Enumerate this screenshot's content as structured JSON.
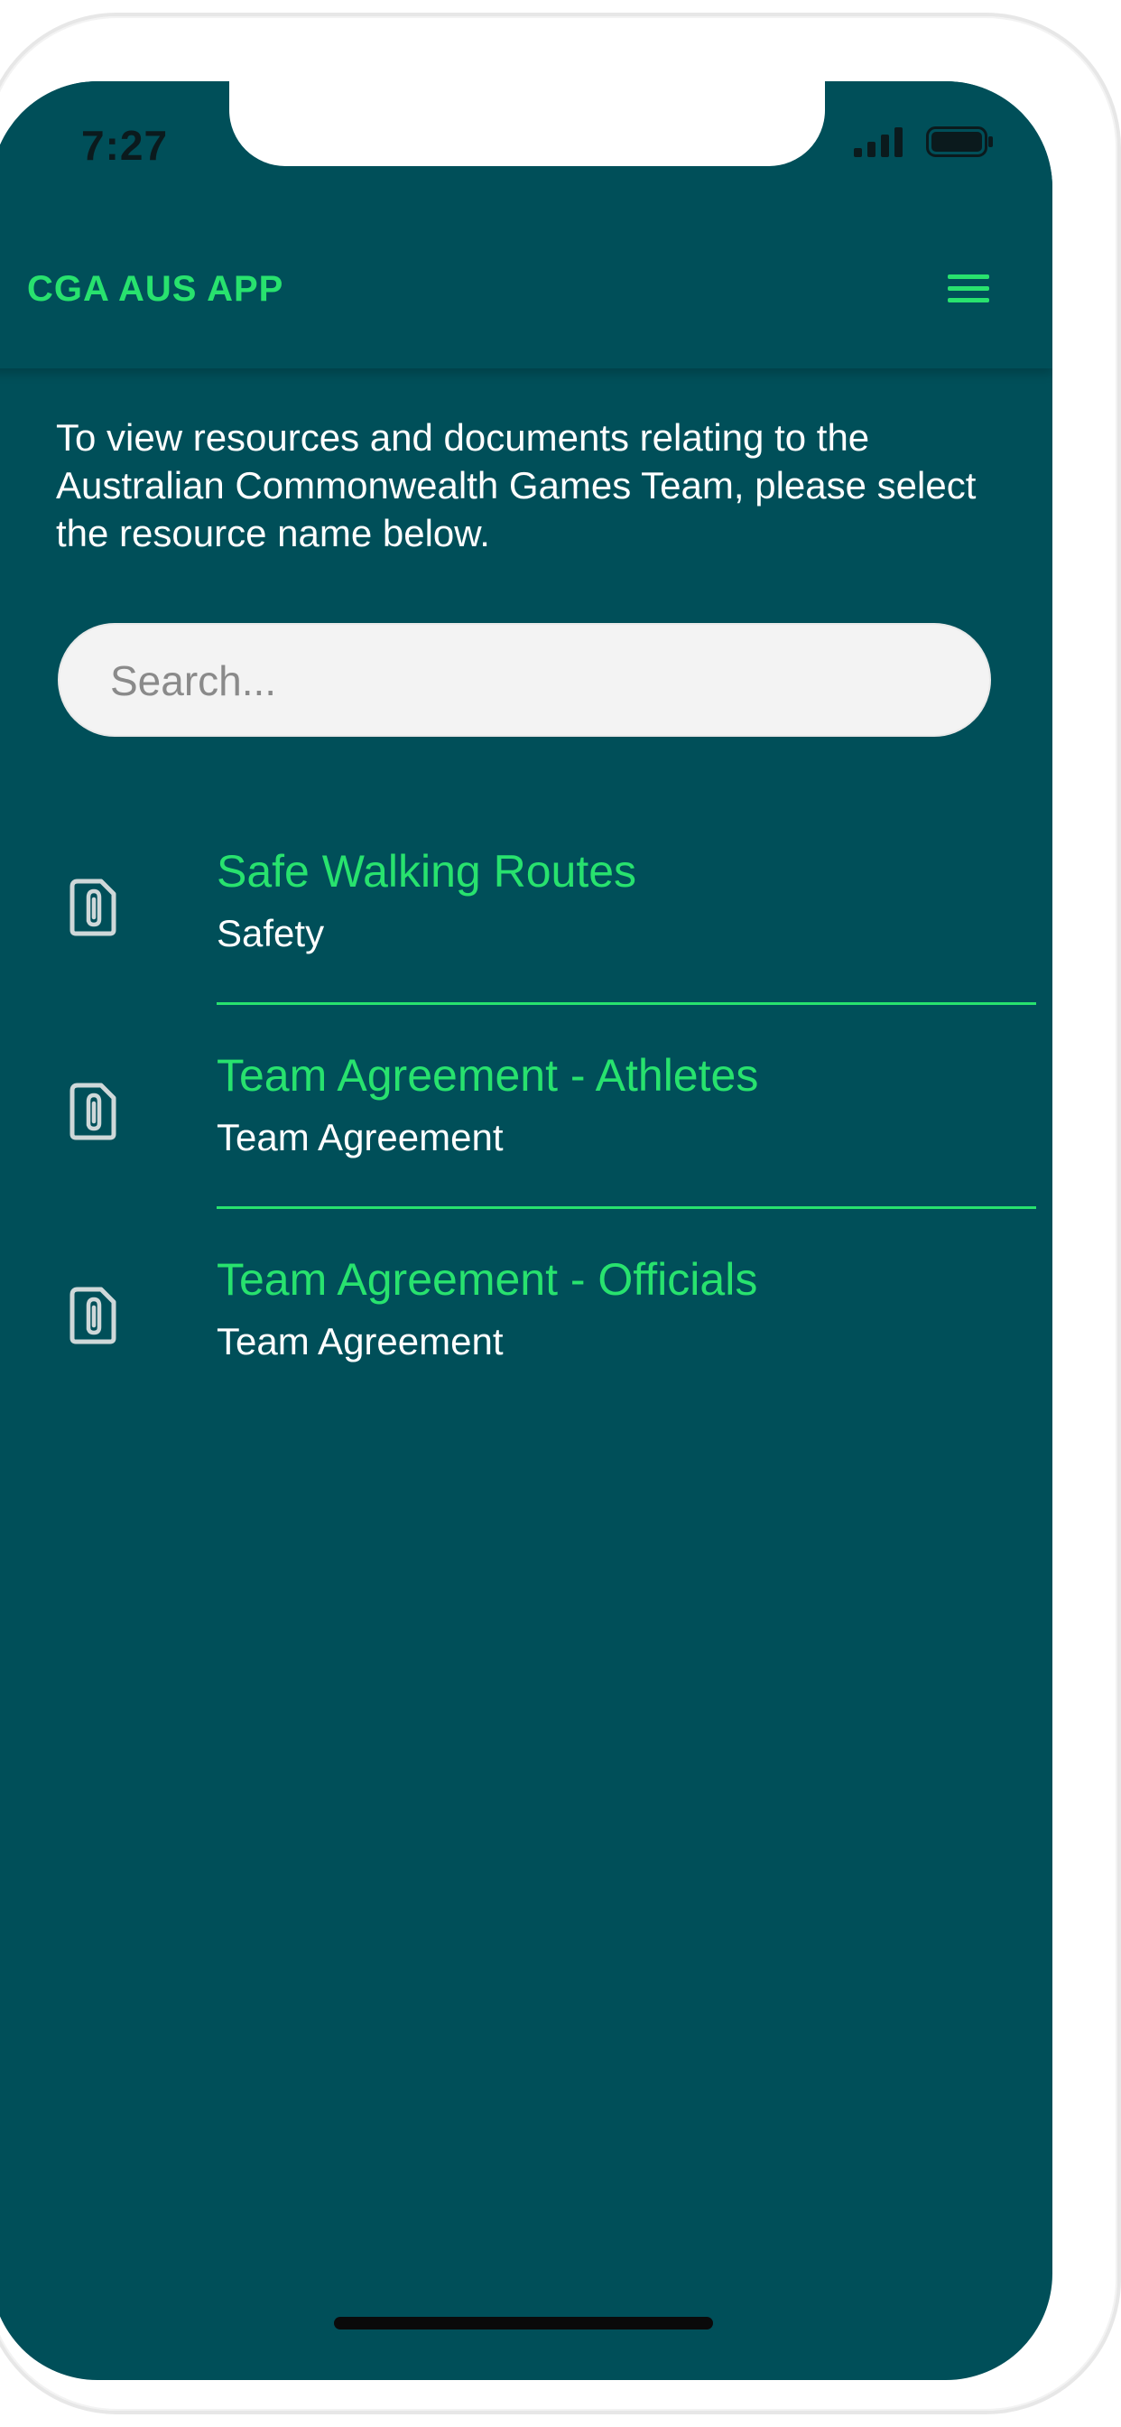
{
  "status_bar": {
    "time": "7:27",
    "signal_icon": "cellular-signal-icon",
    "battery_icon": "battery-full-icon"
  },
  "header": {
    "title": "CGA AUS APP",
    "menu_icon": "hamburger-menu-icon"
  },
  "intro_text": "To view resources and documents relating to the Australian Commonwealth Games Team, please select the resource name below.",
  "search": {
    "placeholder": "Search...",
    "value": ""
  },
  "resources": [
    {
      "title": "Safe Walking Routes",
      "category": "Safety",
      "icon": "paperclip-document-icon"
    },
    {
      "title": "Team Agreement - Athletes",
      "category": "Team Agreement",
      "icon": "paperclip-document-icon"
    },
    {
      "title": "Team Agreement - Officials",
      "category": "Team Agreement",
      "icon": "paperclip-document-icon"
    }
  ],
  "colors": {
    "background": "#004f59",
    "accent": "#28e26e",
    "text": "#ffffff",
    "search_bg": "#f3f3f3"
  }
}
